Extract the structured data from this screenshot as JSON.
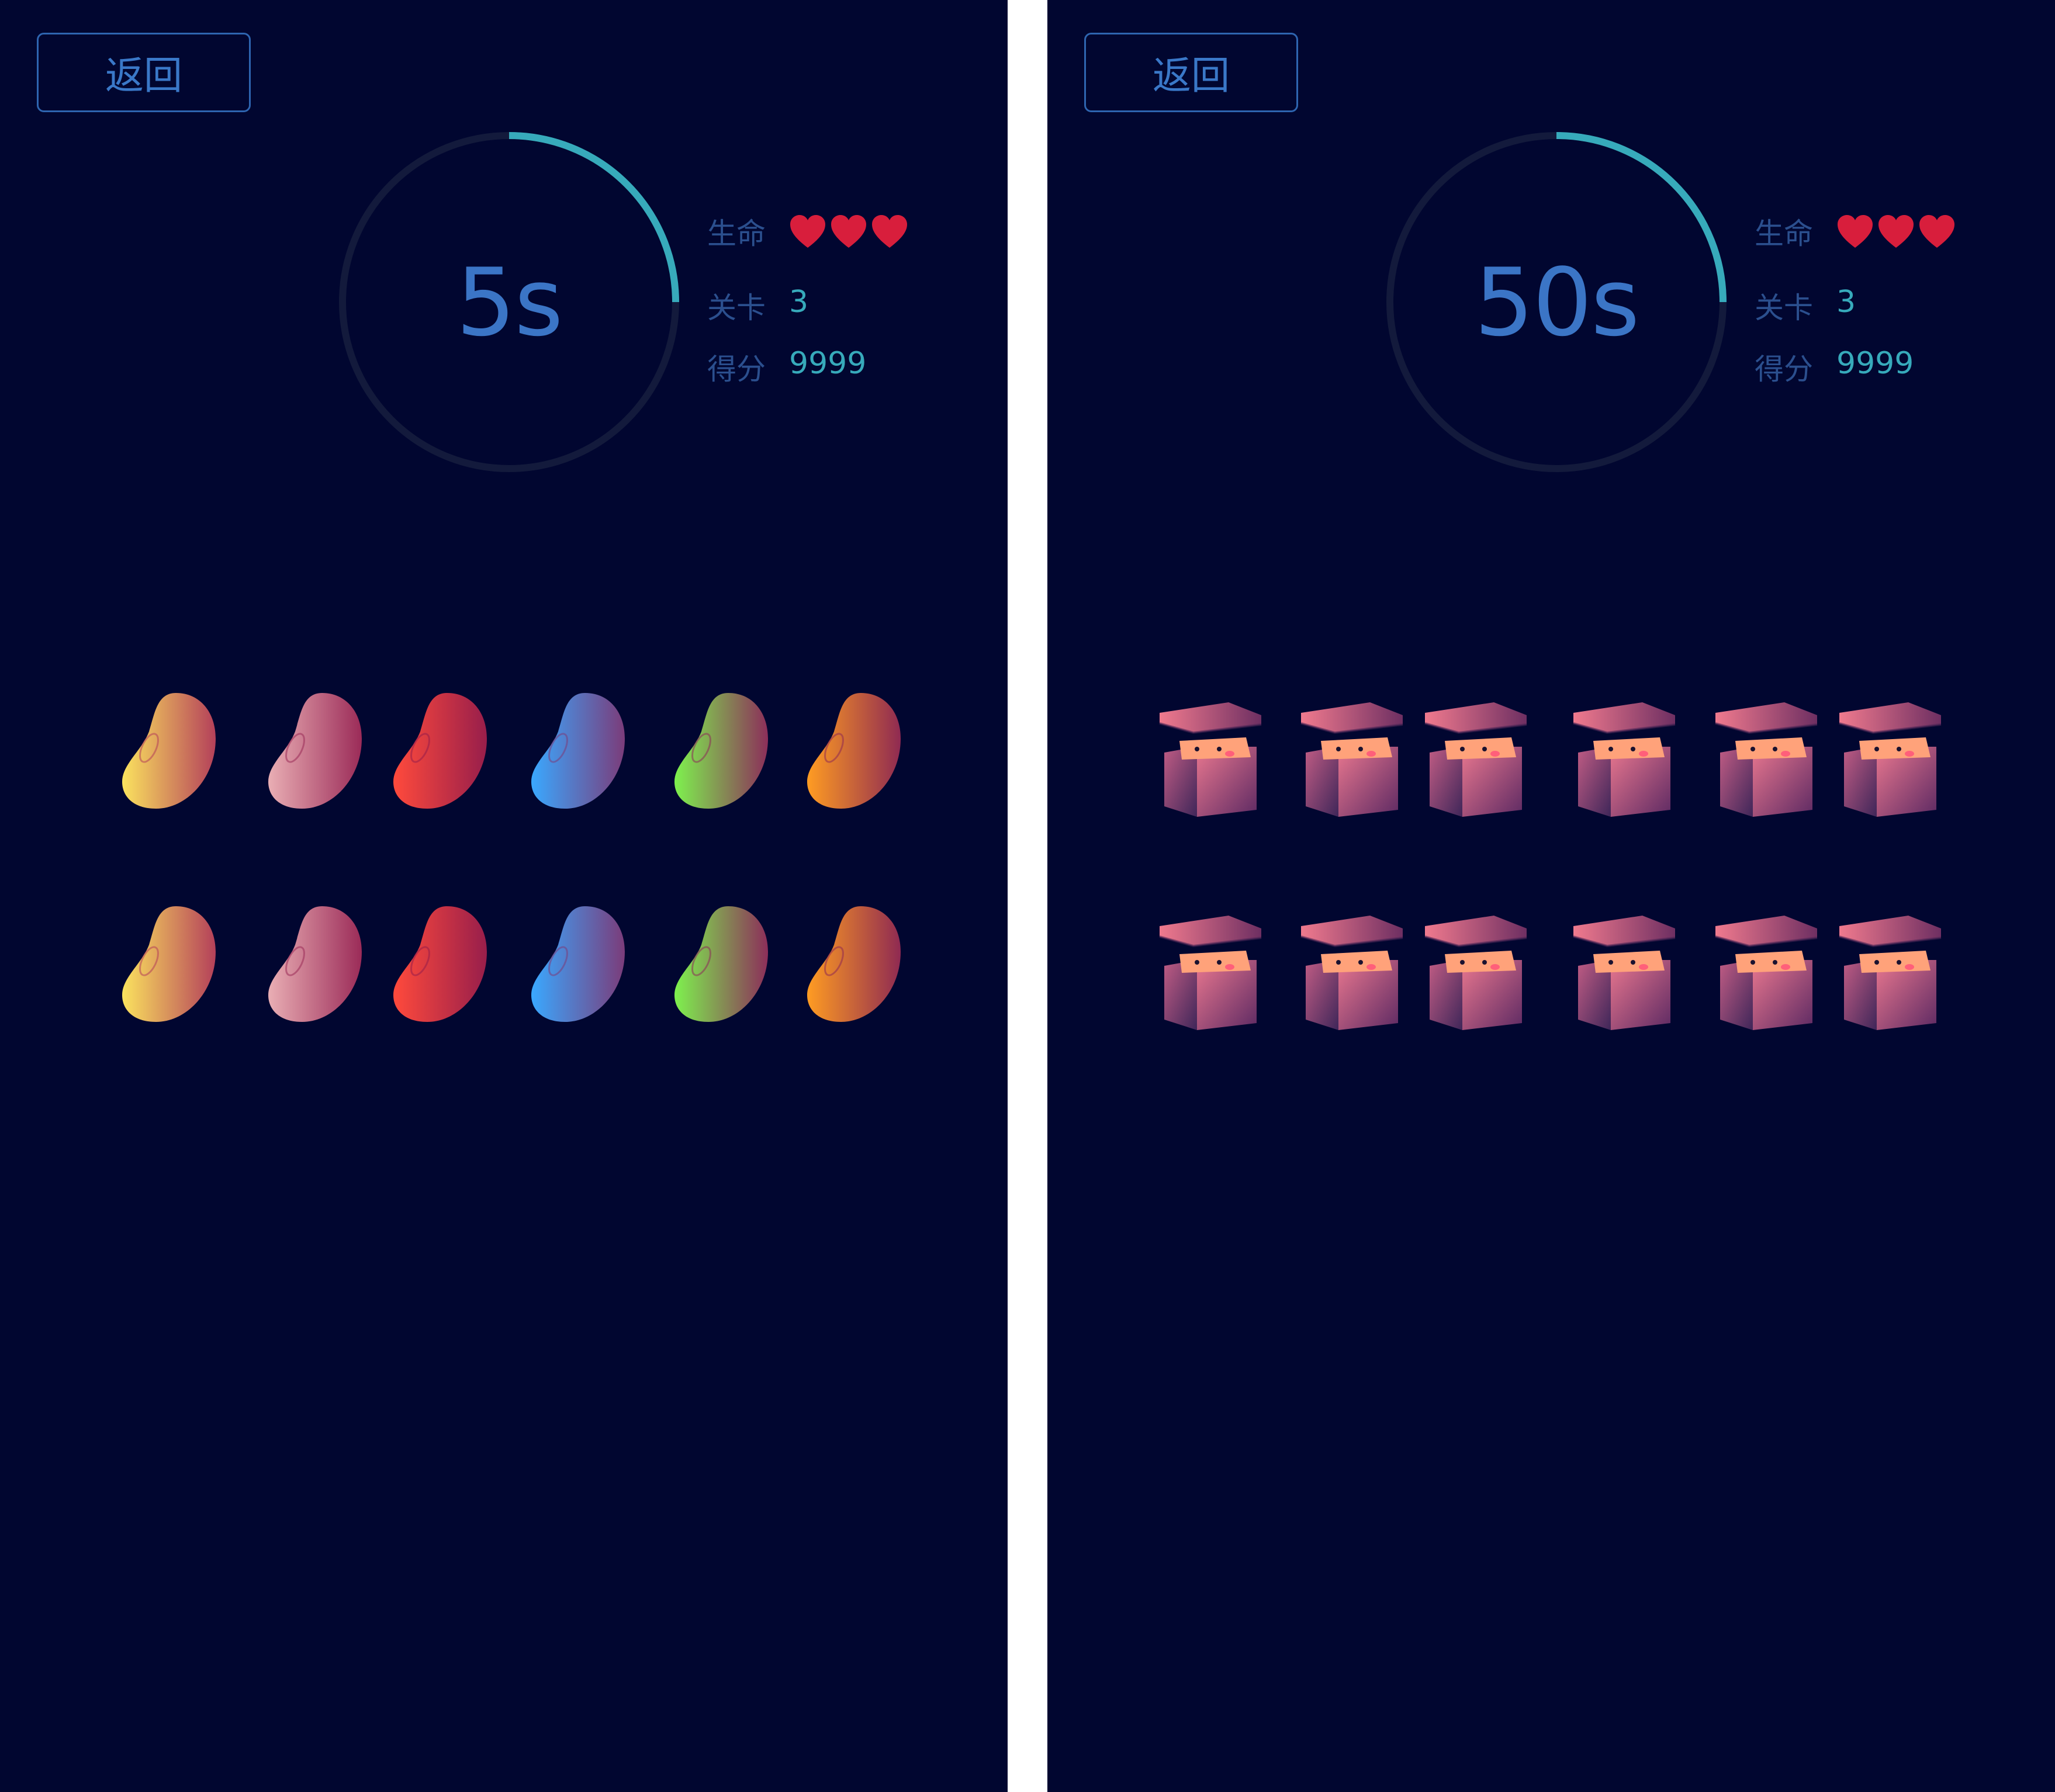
{
  "screens": [
    {
      "back_label": "返回",
      "timer": {
        "text": "5s",
        "progress": 0.25
      },
      "stats": {
        "lives_label": "生命",
        "lives": 3,
        "level_label": "关卡",
        "level_value": "3",
        "score_label": "得分",
        "score_value": "9999"
      },
      "board": {
        "item_type": "jelly-bean",
        "rows": [
          [
            "yellow",
            "pink",
            "red",
            "blue",
            "green",
            "orange"
          ],
          [
            "yellow",
            "pink",
            "red",
            "blue",
            "green",
            "orange"
          ]
        ]
      }
    },
    {
      "back_label": "返回",
      "timer": {
        "text": "50s",
        "progress": 0.25
      },
      "stats": {
        "lives_label": "生命",
        "lives": 3,
        "level_label": "关卡",
        "level_value": "3",
        "score_label": "得分",
        "score_value": "9999"
      },
      "board": {
        "item_type": "mystery-box",
        "rows": [
          [
            "box",
            "box",
            "box",
            "box",
            "box",
            "box"
          ],
          [
            "box",
            "box",
            "box",
            "box",
            "box",
            "box"
          ]
        ]
      }
    }
  ],
  "colors": {
    "background": "#010630",
    "divider": "#ffffff",
    "accent_teal": "#37aabb",
    "timer_text": "#3b75c6",
    "heart": "#d81e3c",
    "bean_yellow": [
      "#fbe35e",
      "#b4405a"
    ],
    "bean_pink": [
      "#e9aeb4",
      "#9b2b58"
    ],
    "bean_red": [
      "#ff4a3c",
      "#981e4b"
    ],
    "bean_blue": [
      "#3aa8ff",
      "#7b3c7a"
    ],
    "bean_green": [
      "#7ef24e",
      "#8c2e5a"
    ],
    "bean_orange": [
      "#ff9c22",
      "#8f2a52"
    ]
  }
}
